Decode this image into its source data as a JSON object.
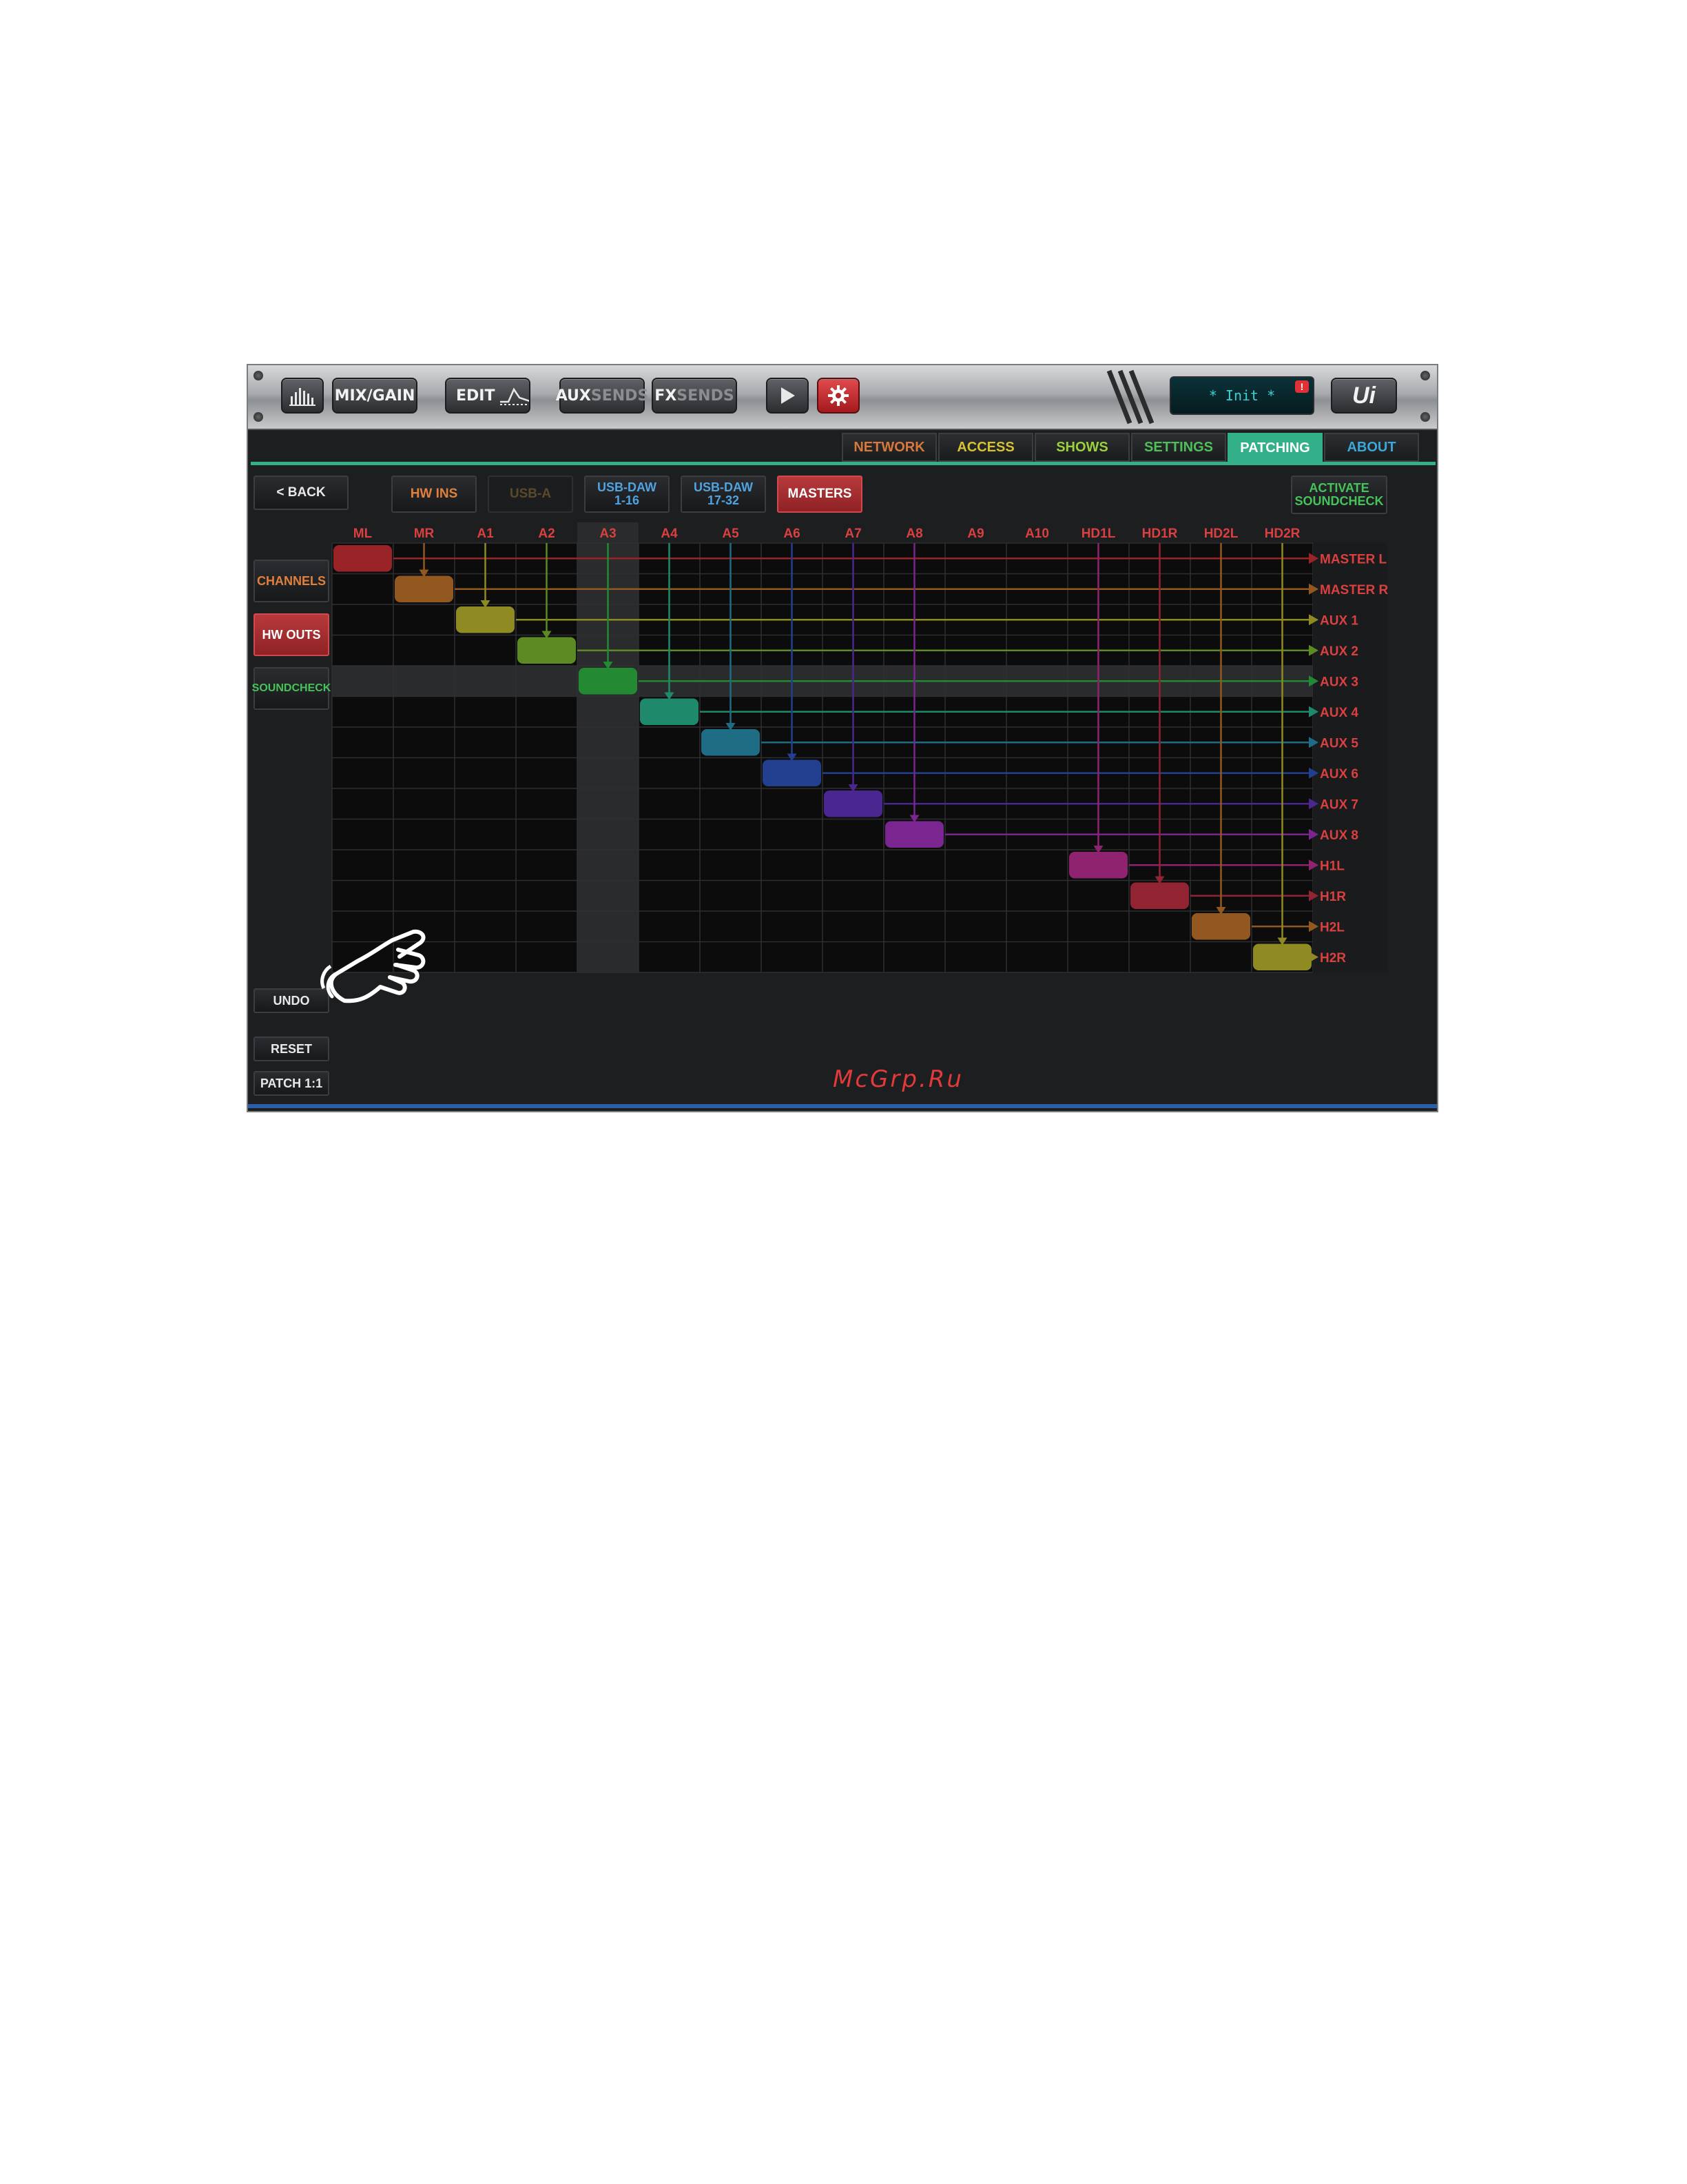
{
  "toolbar": {
    "mix_gain": "MIX/GAIN",
    "edit": "EDIT",
    "aux": "AUX",
    "aux_sends": "SENDS",
    "fx": "FX",
    "fx_sends": "SENDS",
    "status_text": "* Init *",
    "status_badge": "!",
    "brand": "Ui"
  },
  "nav_tabs": [
    {
      "label": "NETWORK",
      "color": "#d8783a",
      "active": false
    },
    {
      "label": "ACCESS",
      "color": "#d7c232",
      "active": false
    },
    {
      "label": "SHOWS",
      "color": "#9ad13c",
      "active": false
    },
    {
      "label": "SETTINGS",
      "color": "#4fc058",
      "active": false
    },
    {
      "label": "PATCHING",
      "color": "#ffffff",
      "active": true
    },
    {
      "label": "ABOUT",
      "color": "#3aa8d8",
      "active": false
    }
  ],
  "subnav": {
    "back": "< BACK",
    "hw_ins": "HW INS",
    "usb_a": "USB-A",
    "usb_daw_1": "USB-DAW\n1-16",
    "usb_daw_2": "USB-DAW\n17-32",
    "masters": "MASTERS",
    "activate": "ACTIVATE\nSOUNDCHECK"
  },
  "sidebar": {
    "channels": "CHANNELS",
    "hw_outs": "HW OUTS",
    "soundcheck": "SOUNDCHECK",
    "undo": "UNDO",
    "reset": "RESET",
    "patch_1_1": "PATCH 1:1"
  },
  "matrix": {
    "columns": [
      "ML",
      "MR",
      "A1",
      "A2",
      "A3",
      "A4",
      "A5",
      "A6",
      "A7",
      "A8",
      "A9",
      "A10",
      "HD1L",
      "HD1R",
      "HD2L",
      "HD2R"
    ],
    "rows": [
      "MASTER L",
      "MASTER R",
      "AUX 1",
      "AUX 2",
      "AUX 3",
      "AUX 4",
      "AUX 5",
      "AUX 6",
      "AUX 7",
      "AUX 8",
      "H1L",
      "H1R",
      "H2L",
      "H2R"
    ],
    "highlight_column": "A3",
    "highlight_row": "AUX 3",
    "patches": [
      {
        "row": "MASTER L",
        "column": "ML",
        "color": "#9a2327"
      },
      {
        "row": "MASTER R",
        "column": "MR",
        "color": "#93581f"
      },
      {
        "row": "AUX 1",
        "column": "A1",
        "color": "#8f8a22"
      },
      {
        "row": "AUX 2",
        "column": "A2",
        "color": "#5d8a22"
      },
      {
        "row": "AUX 3",
        "column": "A3",
        "color": "#238a33"
      },
      {
        "row": "AUX 4",
        "column": "A4",
        "color": "#1f8a6b"
      },
      {
        "row": "AUX 5",
        "column": "A5",
        "color": "#1f6d85"
      },
      {
        "row": "AUX 6",
        "column": "A6",
        "color": "#22408f"
      },
      {
        "row": "AUX 7",
        "column": "A7",
        "color": "#4a2690"
      },
      {
        "row": "AUX 8",
        "column": "A8",
        "color": "#7a2590"
      },
      {
        "row": "H1L",
        "column": "HD1L",
        "color": "#8f2370"
      },
      {
        "row": "H1R",
        "column": "HD1R",
        "color": "#922332"
      },
      {
        "row": "H2L",
        "column": "HD2L",
        "color": "#93581f"
      },
      {
        "row": "H2R",
        "column": "HD2R",
        "color": "#8f8a22"
      }
    ]
  },
  "watermark": "McGrp.Ru",
  "colors": {
    "accent_green": "#33b089",
    "label_red": "#d9403f",
    "orange": "#e0803c",
    "blue": "#4fa3e0",
    "green": "#46c45a"
  }
}
